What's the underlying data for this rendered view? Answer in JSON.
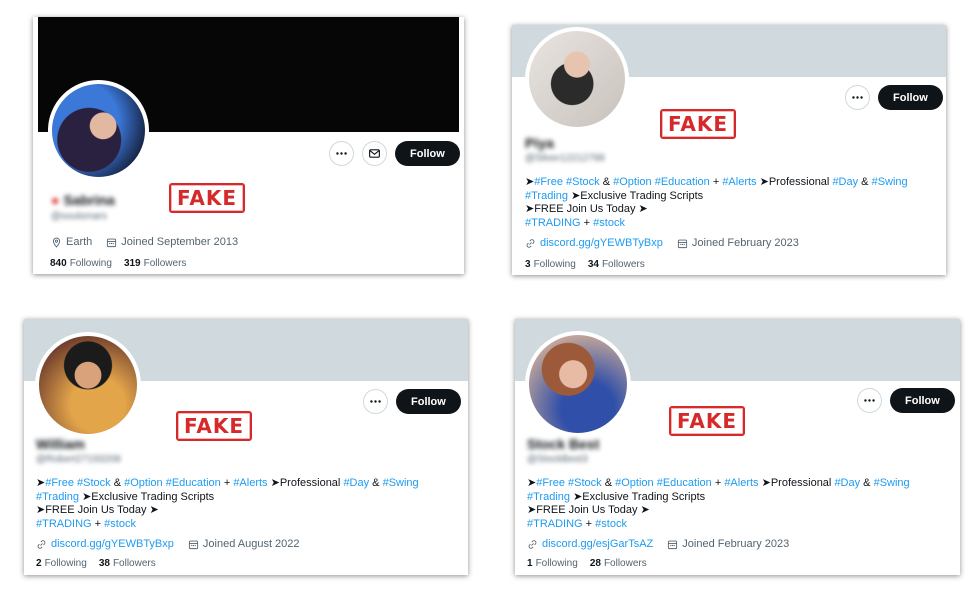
{
  "colors": {
    "follow_bg": "#0f1419",
    "link": "#1d9bf0",
    "stamp": "#d62a2a",
    "banner": "#cfd9de"
  },
  "stamp_text": "FAKE",
  "follow_label": "Follow",
  "icons": [
    "more-icon",
    "mail-icon",
    "location-icon",
    "calendar-icon",
    "link-icon"
  ],
  "profiles": [
    {
      "name": "Sabrina",
      "handle": "@soulsmars",
      "location": "Earth",
      "joined": "Joined September 2013",
      "following_count": "840",
      "following_label": "Following",
      "followers_count": "319",
      "followers_label": "Followers"
    },
    {
      "name": "Piya",
      "handle": "@Silver12212798",
      "bio_lines": [
        [
          "➤",
          "#Free",
          " ",
          "#Stock",
          " & ",
          "#Option",
          " ",
          "#Education",
          " + ",
          "#Alerts",
          " ➤Professional ",
          "#Day",
          " & ",
          "#Swing"
        ],
        [
          "#Trading",
          " ➤Exclusive Trading Scripts"
        ],
        [
          "➤FREE Join Us Today ➤"
        ],
        [
          "#TRADING",
          " + ",
          "#stock"
        ]
      ],
      "link": "discord.gg/gYEWBTyBxp",
      "joined": "Joined February 2023",
      "following_count": "3",
      "following_label": "Following",
      "followers_count": "34",
      "followers_label": "Followers"
    },
    {
      "name": "William",
      "handle": "@Robert27193208",
      "bio_lines": [
        [
          "➤",
          "#Free",
          " ",
          "#Stock",
          " & ",
          "#Option",
          " ",
          "#Education",
          " + ",
          "#Alerts",
          " ➤Professional ",
          "#Day",
          " & ",
          "#Swing"
        ],
        [
          "#Trading",
          " ➤Exclusive Trading Scripts"
        ],
        [
          "➤FREE Join Us Today ➤"
        ],
        [
          "#TRADING",
          " + ",
          "#stock"
        ]
      ],
      "link": "discord.gg/gYEWBTyBxp",
      "joined": "Joined August 2022",
      "following_count": "2",
      "following_label": "Following",
      "followers_count": "38",
      "followers_label": "Followers"
    },
    {
      "name": "Stock Best",
      "handle": "@StockBest3",
      "bio_lines": [
        [
          "➤",
          "#Free",
          " ",
          "#Stock",
          " & ",
          "#Option",
          " ",
          "#Education",
          " + ",
          "#Alerts",
          " ➤Professional ",
          "#Day",
          " & ",
          "#Swing"
        ],
        [
          "#Trading",
          " ➤Exclusive Trading Scripts"
        ],
        [
          "➤FREE Join Us Today ➤"
        ],
        [
          "#TRADING",
          " + ",
          "#stock"
        ]
      ],
      "link": "discord.gg/esjGarTsAZ",
      "joined": "Joined February 2023",
      "following_count": "1",
      "following_label": "Following",
      "followers_count": "28",
      "followers_label": "Followers"
    }
  ]
}
